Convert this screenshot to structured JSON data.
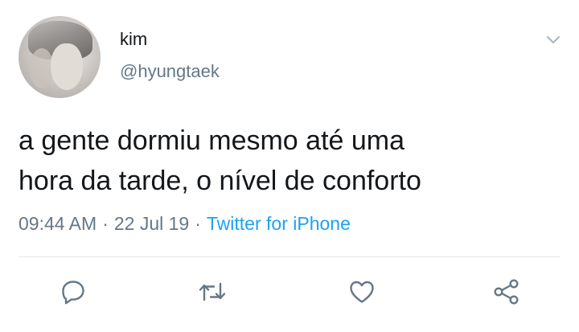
{
  "user": {
    "name": "kim",
    "handle": "@hyungtaek"
  },
  "tweet": {
    "lines": [
      "a gente dormiu mesmo até uma",
      "hora da tarde, o nível de conforto"
    ],
    "time": "09:44 AM",
    "date": "22 Jul 19",
    "source": "Twitter for iPhone",
    "separator": "·"
  },
  "icons": {
    "more": "chevron-down-icon",
    "reply": "reply-icon",
    "retweet": "retweet-icon",
    "like": "heart-icon",
    "share": "share-icon"
  },
  "colors": {
    "text": "#14171a",
    "secondary": "#657786",
    "accent": "#1da1f2",
    "divider": "#e1e8ed"
  }
}
